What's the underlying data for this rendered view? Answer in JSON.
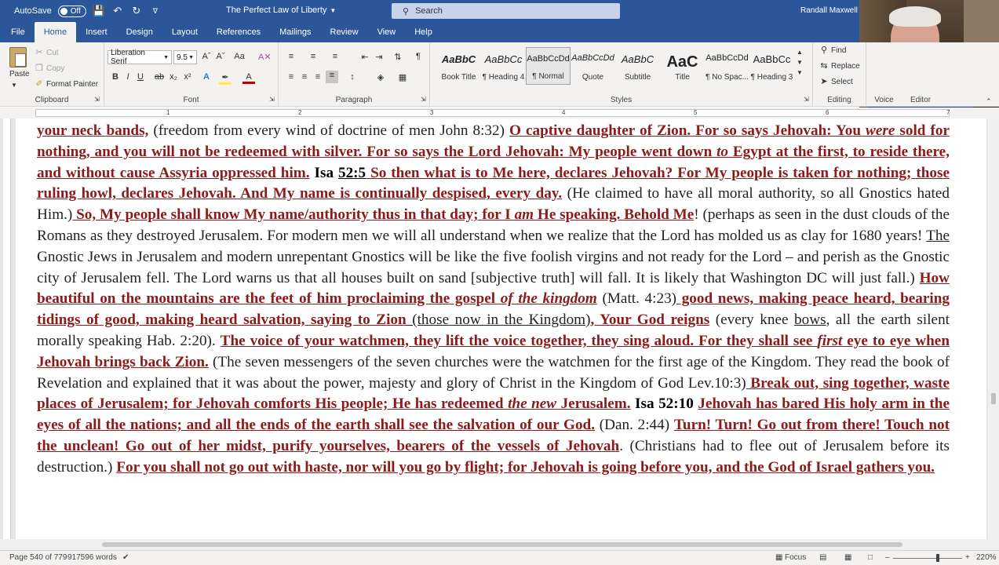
{
  "titlebar": {
    "autosave_label": "AutoSave",
    "autosave_state": "Off",
    "doc_title": "The Perfect Law of Liberty",
    "search_placeholder": "Search",
    "user_name": "Randall Maxwell"
  },
  "tabs": [
    "File",
    "Home",
    "Insert",
    "Design",
    "Layout",
    "References",
    "Mailings",
    "Review",
    "View",
    "Help"
  ],
  "active_tab": "Home",
  "ribbon": {
    "clipboard": {
      "paste": "Paste",
      "cut": "Cut",
      "copy": "Copy",
      "format_painter": "Format Painter",
      "label": "Clipboard"
    },
    "font": {
      "family": "Liberation Serif",
      "size": "9.5",
      "label": "Font"
    },
    "paragraph": {
      "label": "Paragraph"
    },
    "styles": {
      "label": "Styles",
      "items": [
        {
          "sample": "AaBbC",
          "name": "Book Title"
        },
        {
          "sample": "AaBbCc",
          "name": "¶ Heading 4"
        },
        {
          "sample": "AaBbCcDd",
          "name": "¶ Normal"
        },
        {
          "sample": "AaBbCcDd",
          "name": "Quote"
        },
        {
          "sample": "AaBbC",
          "name": "Subtitle"
        },
        {
          "sample": "AaC",
          "name": "Title"
        },
        {
          "sample": "AaBbCcDd",
          "name": "¶ No Spac..."
        },
        {
          "sample": "AaBbCc",
          "name": "¶ Heading 3"
        }
      ]
    },
    "editing": {
      "find": "Find",
      "replace": "Replace",
      "select": "Select",
      "label": "Editing"
    },
    "voice": {
      "label": "Voice"
    },
    "editor": {
      "label": "Editor"
    }
  },
  "ruler_numbers": [
    "1",
    "2",
    "3",
    "4",
    "5",
    "6",
    "7"
  ],
  "document": {
    "s1": "your neck bands,",
    "t1": " (freedom from every wind of doctrine of men John 8:32) ",
    "s2": "O captive daughter of Zion. For so says Jehovah: You ",
    "s2i": "were",
    "s3": " sold for nothing, and you will not be redeemed with silver. For so says the Lord Jehovah: My people went down ",
    "s3i": "to",
    "s4": " Egypt at the first, to reside there, and without cause Assyria oppressed him.",
    "r1": " Isa ",
    "r1u": "52:5",
    "s5": "  So then what is to Me here, declares Jehovah? For My people is taken for nothing; those ruling howl, declares Jehovah. And My name is continually despised, every day.",
    "t2": " (He claimed to have all moral authority, so all Gnostics hated Him.)",
    "s6": " So, My people shall know My name/authority thus in that day; for I ",
    "s6i": "am",
    "s7": " He speaking. Behold Me",
    "t3": "! (perhaps as seen in the dust clouds of the Romans as they destroyed Jerusalem. For modern men we will all understand when we realize that the Lord has molded us as clay for 1680 years! ",
    "t3u": "The",
    "t4": " Gnostic Jews in Jerusalem and modern unrepentant Gnostics will be like the five foolish virgins and not ready for the Lord – and perish as the Gnostic city of Jerusalem fell.  The Lord warns us that all houses built on sand [subjective truth] will fall.  It is likely that Washington DC will just fall.)  ",
    "s8": "How beautiful on the mountains are the feet of him proclaiming the gospel ",
    "s8i": "of the kingdom",
    "t5": " (Matt. 4:23)",
    "s9": " good news, making peace heard, bearing tidings of good, making heard salvation, saying to Zion",
    "t6": " (those now in the Kingdom)",
    "s10": ", Your God reigns",
    "t7": " (every knee ",
    "t7u": "bows",
    "t8": ", all the earth silent morally speaking Hab. 2:20). ",
    "s11": "The voice of your watchmen, they lift the voice together, they sing aloud. For they shall see ",
    "s11i": "first",
    "s12": " eye to eye when Jehovah brings back Zion.",
    "t9": " (The seven messengers of the seven churches were the watchmen for the first age of the Kingdom.  They read the book of Revelation and explained that it was about the power, majesty and glory of Christ in the Kingdom of God Lev.10:3)",
    "s13": "  Break out, sing together, waste places of Jerusalem; for Jehovah comforts His people; He has redeemed ",
    "s13i": "the new",
    "s14": " Jerusalem.",
    "r2": " Isa 52:10 ",
    "s15": "Jehovah has bared His holy arm in the eyes of all the nations; and all the ends of the earth shall see the salvation of our God.",
    "t10": " (Dan. 2:44) ",
    "s16": "Turn! Turn! Go out from there! Touch not the unclean! Go out of her midst, purify yourselves, bearers of the vessels of Jehovah",
    "t11": ". (Christians had to flee out of Jerusalem before its destruction.) ",
    "s17": "For you shall not go out with haste, nor will you go by flight; for Jehovah is going before you, and the God of Israel gathers you."
  },
  "status": {
    "page": "Page 540 of 779",
    "words": "917596 words",
    "focus": "Focus",
    "zoom": "220%"
  },
  "colors": {
    "title_bar": "#2b579a",
    "scripture_text": "#8b1a1a"
  }
}
